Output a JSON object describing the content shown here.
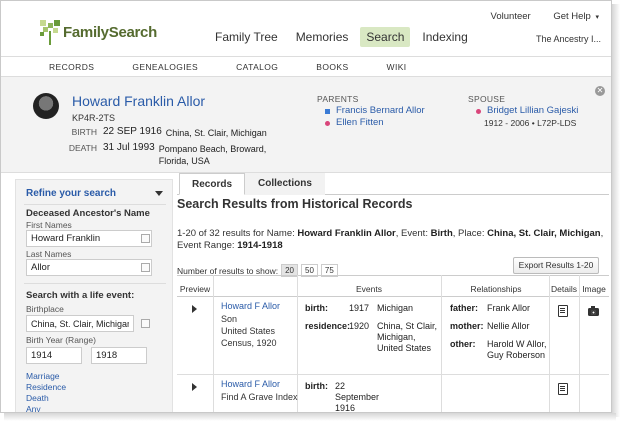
{
  "header": {
    "brand_first": "Family",
    "brand_second": "Search",
    "nav": [
      "Family Tree",
      "Memories",
      "Search",
      "Indexing"
    ],
    "active_nav": "Search",
    "volunteer": "Volunteer",
    "get_help": "Get Help",
    "tagline": "The Ancestry I..."
  },
  "subnav": [
    "RECORDS",
    "GENEALOGIES",
    "CATALOG",
    "BOOKS",
    "WIKI"
  ],
  "person": {
    "name": "Howard Franklin Allor",
    "id": "KP4R-2TS",
    "birth_label": "BIRTH",
    "birth_date": "22 SEP 1916",
    "birth_place": "China, St. Clair, Michigan",
    "death_label": "DEATH",
    "death_date": "31 Jul 1993",
    "death_place": "Pompano Beach, Broward, Florida, USA",
    "parents_label": "PARENTS",
    "father": "Francis Bernard Allor",
    "mother": "Ellen Fitten",
    "spouse_label": "SPOUSE",
    "spouse": "Bridget Lillian Gajeski",
    "spouse_detail": "1912 - 2006 • L72P-LDS"
  },
  "sidebar": {
    "refine": "Refine your search",
    "deceased_title": "Deceased Ancestor's Name",
    "first_label": "First Names",
    "first_value": "Howard Franklin",
    "last_label": "Last Names",
    "last_value": "Allor",
    "life_title": "Search with a life event:",
    "birthplace_label": "Birthplace",
    "birthplace_value": "China, St. Clair, Michigan",
    "birthyear_label": "Birth Year (Range)",
    "year_from": "1914",
    "year_to": "1918",
    "links": [
      "Marriage",
      "Residence",
      "Death",
      "Any"
    ]
  },
  "main": {
    "tabs": [
      "Records",
      "Collections"
    ],
    "heading": "Search Results from Historical Records",
    "summary_pre": "1-20 of 32 results for Name: ",
    "summary_name": "Howard Franklin Allor",
    "summary_event_pre": ", Event: ",
    "summary_event": "Birth",
    "summary_place_pre": ", Place: ",
    "summary_place": "China, St. Clair, Michigan",
    "summary_range_pre": ", Event Range: ",
    "summary_range": "1914-1918",
    "perpage_label": "Number of results to show:",
    "perpage_options": [
      "20",
      "50",
      "75"
    ],
    "export_label": "Export Results 1-20",
    "columns": [
      "Preview",
      "Events",
      "Relationships",
      "Details",
      "Image"
    ],
    "rows": [
      {
        "name": "Howard F Allor",
        "subtitle": "Son\nUnited States Census, 1920",
        "events": [
          {
            "label": "birth:",
            "year": "1917",
            "place": "Michigan"
          },
          {
            "label": "residence:",
            "year": "1920",
            "place": "China, St Clair, Michigan, United States"
          }
        ],
        "relationships": [
          {
            "label": "father:",
            "value": "Frank Allor"
          },
          {
            "label": "mother:",
            "value": "Nellie Allor"
          },
          {
            "label": "other:",
            "value": "Harold W Allor, Guy Roberson"
          }
        ]
      },
      {
        "name": "Howard F Allor",
        "subtitle": "Find A Grave Index",
        "events": [
          {
            "label": "birth:",
            "year": "22 September 1916",
            "place": ""
          }
        ],
        "relationships": []
      }
    ]
  }
}
